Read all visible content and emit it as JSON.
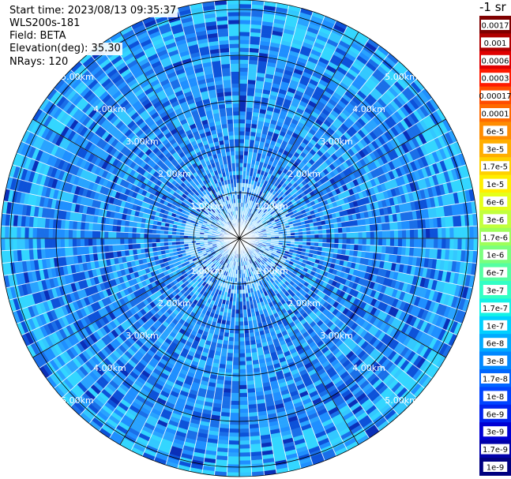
{
  "header": {
    "start_time": "Start time: 2023/08/13 09:35:37",
    "instrument": "WLS200s-181",
    "field": "Field: BETA",
    "elevation": "Elevation(deg): 35.30",
    "nrays": "NRays: 120"
  },
  "chart_data": {
    "type": "heatmap",
    "projection": "polar",
    "range_rings_km": [
      1,
      2,
      3,
      4,
      5
    ],
    "ring_labels": [
      "1.00km",
      "2.00km",
      "3.00km",
      "4.00km",
      "5.00km"
    ],
    "n_rays": 120,
    "field": "BETA",
    "colorbar": {
      "title": "-1 sr",
      "labels": [
        "0.0017",
        "0.001",
        "0.0006",
        "0.0003",
        "0.00017",
        "0.0001",
        "6e-5",
        "3e-5",
        "1.7e-5",
        "1e-5",
        "6e-6",
        "3e-6",
        "1.7e-6",
        "1e-6",
        "6e-7",
        "3e-7",
        "1.7e-7",
        "1e-7",
        "6e-8",
        "3e-8",
        "1.7e-8",
        "1e-8",
        "6e-9",
        "3e-9",
        "1.7e-9",
        "1e-9"
      ],
      "colors": [
        "#7f0000",
        "#b00000",
        "#e00000",
        "#ff1a00",
        "#ff4d00",
        "#ff6a00",
        "#ff8c00",
        "#ffae00",
        "#ffd000",
        "#ffee00",
        "#e6ff1a",
        "#c2ff3d",
        "#9dff5a",
        "#7aff7d",
        "#55ffa2",
        "#33ffc4",
        "#14f2e6",
        "#00d0ff",
        "#00aaff",
        "#0088ff",
        "#0066ff",
        "#0044ff",
        "#0022ee",
        "#0000d4",
        "#0000aa",
        "#000080"
      ]
    },
    "dominant_colors": [
      "#1f8fff",
      "#29a3ff",
      "#1a6fe8",
      "#33c8ff",
      "#0d52d9"
    ]
  }
}
